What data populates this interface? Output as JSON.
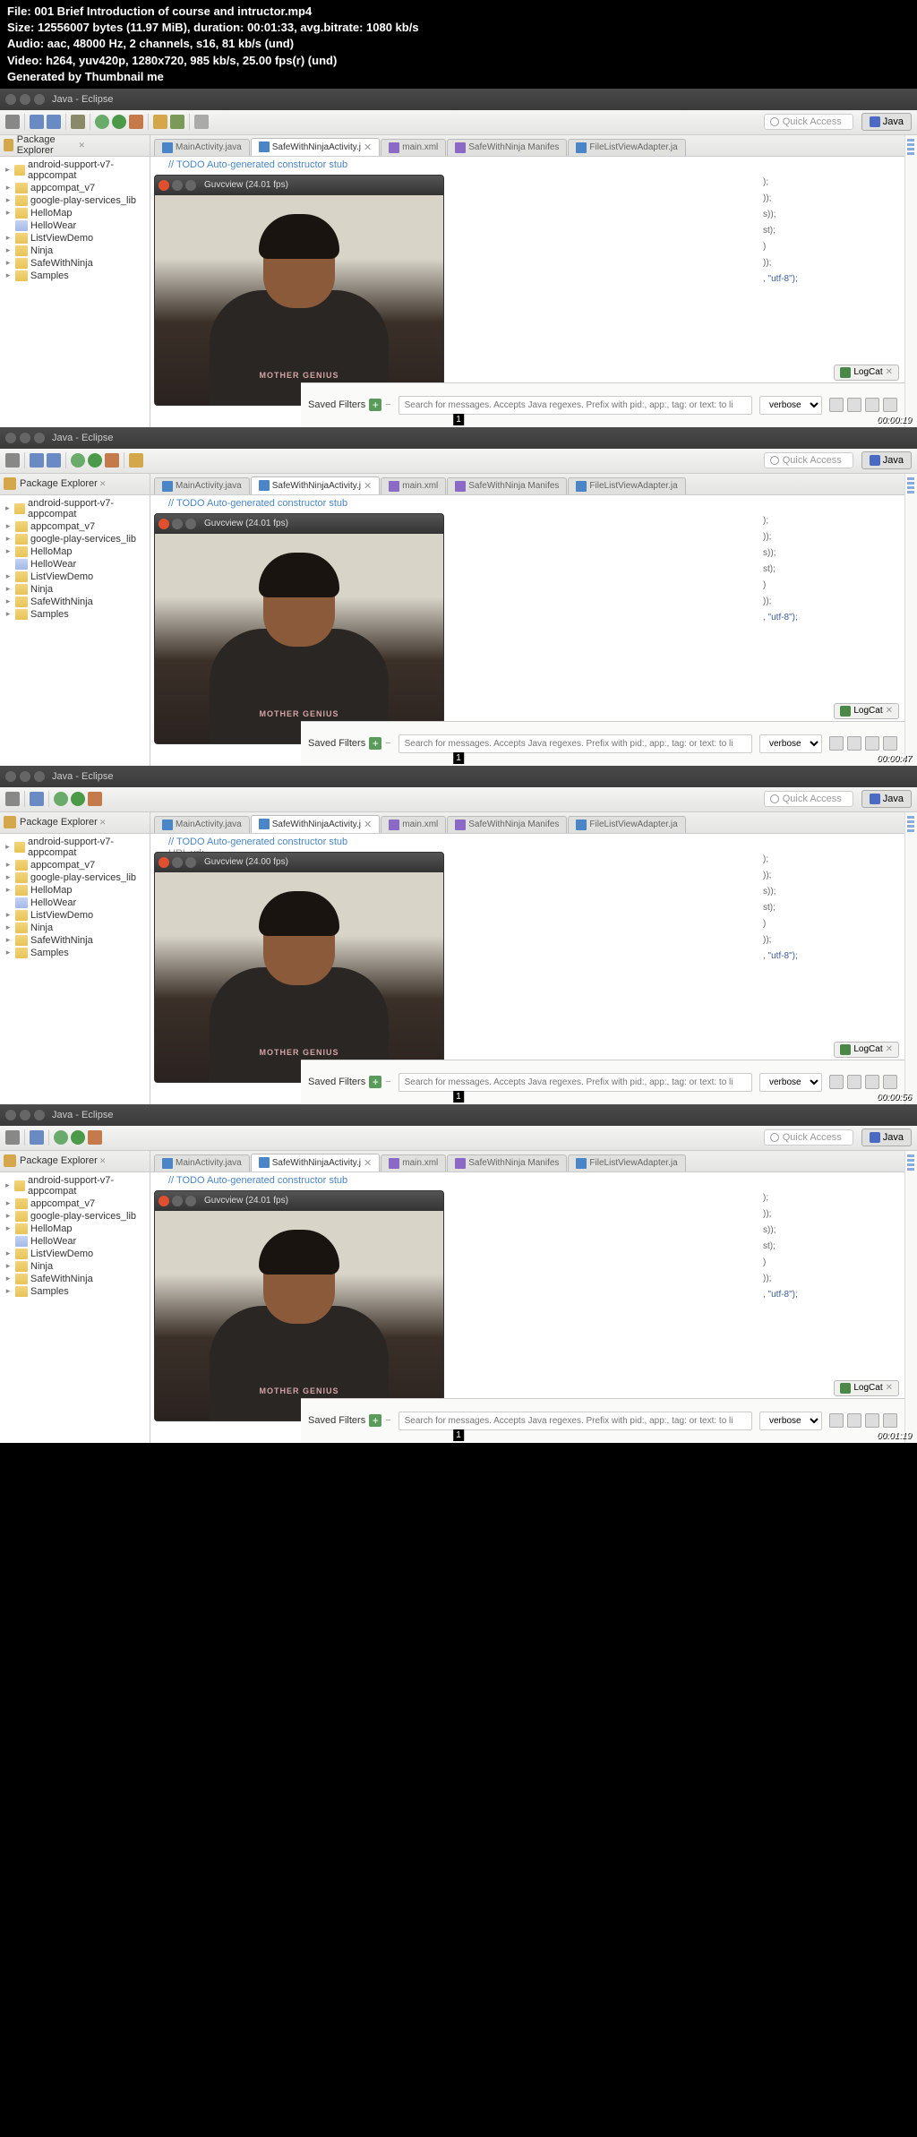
{
  "header": {
    "file_label": "File:",
    "file_value": "001 Brief Introduction of course and intructor.mp4",
    "size_label": "Size:",
    "size_value": "12556007 bytes (11.97 MiB), duration: 00:01:33, avg.bitrate: 1080 kb/s",
    "audio_label": "Audio:",
    "audio_value": "aac, 48000 Hz, 2 channels, s16, 81 kb/s (und)",
    "video_label": "Video:",
    "video_value": "h264, yuv420p, 1280x720, 985 kb/s, 25.00 fps(r) (und)",
    "generated": "Generated by Thumbnail me"
  },
  "eclipse": {
    "window_title": "Java - Eclipse",
    "quick_access": "Quick Access",
    "perspective": "Java",
    "package_explorer": {
      "title": "Package Explorer",
      "items": [
        "android-support-v7-appcompat",
        "appcompat_v7",
        "google-play-services_lib",
        "HelloMap",
        "HelloWear",
        "ListViewDemo",
        "Ninja",
        "SafeWithNinja",
        "Samples"
      ]
    },
    "editor_tabs": [
      "MainActivity.java",
      "SafeWithNinjaActivity.j",
      "main.xml",
      "SafeWithNinja Manifes",
      "FileListViewAdapter.ja"
    ],
    "code_comment": "// TODO Auto-generated constructor stub",
    "code_url": "URL url;",
    "video_window_title_2401": "Guvcview  (24.01 fps)",
    "video_window_title_2400": "Guvcview  (24.00 fps)",
    "shirt_text": "MOTHER  GENIUS",
    "code_snippets": {
      "s1": ");",
      "s2": "));",
      "s3": "s));",
      "s4": "st);",
      "s5": ")",
      "s6": ", \"utf-8\");"
    },
    "logcat": "LogCat",
    "saved_filters": "Saved Filters",
    "search_placeholder": "Search for messages. Accepts Java regexes. Prefix with pid:, app:, tag: or text: to li",
    "verbose": "verbose"
  },
  "frames": [
    {
      "number": "1",
      "timestamp": "00:00:19",
      "fps": "24.01"
    },
    {
      "number": "1",
      "timestamp": "00:00:47",
      "fps": "24.01"
    },
    {
      "number": "1",
      "timestamp": "00:00:56",
      "fps": "24.00"
    },
    {
      "number": "1",
      "timestamp": "00:01:19",
      "fps": "24.01"
    }
  ]
}
